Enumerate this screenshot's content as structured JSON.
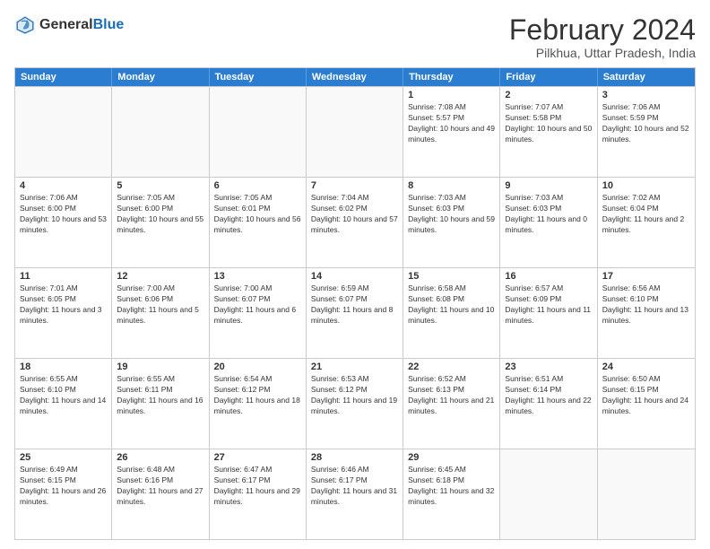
{
  "logo": {
    "general": "General",
    "blue": "Blue"
  },
  "title": "February 2024",
  "location": "Pilkhua, Uttar Pradesh, India",
  "header_days": [
    "Sunday",
    "Monday",
    "Tuesday",
    "Wednesday",
    "Thursday",
    "Friday",
    "Saturday"
  ],
  "rows": [
    [
      {
        "day": "",
        "empty": true
      },
      {
        "day": "",
        "empty": true
      },
      {
        "day": "",
        "empty": true
      },
      {
        "day": "",
        "empty": true
      },
      {
        "day": "1",
        "sunrise": "7:08 AM",
        "sunset": "5:57 PM",
        "daylight": "10 hours and 49 minutes."
      },
      {
        "day": "2",
        "sunrise": "7:07 AM",
        "sunset": "5:58 PM",
        "daylight": "10 hours and 50 minutes."
      },
      {
        "day": "3",
        "sunrise": "7:06 AM",
        "sunset": "5:59 PM",
        "daylight": "10 hours and 52 minutes."
      }
    ],
    [
      {
        "day": "4",
        "sunrise": "7:06 AM",
        "sunset": "6:00 PM",
        "daylight": "10 hours and 53 minutes."
      },
      {
        "day": "5",
        "sunrise": "7:05 AM",
        "sunset": "6:00 PM",
        "daylight": "10 hours and 55 minutes."
      },
      {
        "day": "6",
        "sunrise": "7:05 AM",
        "sunset": "6:01 PM",
        "daylight": "10 hours and 56 minutes."
      },
      {
        "day": "7",
        "sunrise": "7:04 AM",
        "sunset": "6:02 PM",
        "daylight": "10 hours and 57 minutes."
      },
      {
        "day": "8",
        "sunrise": "7:03 AM",
        "sunset": "6:03 PM",
        "daylight": "10 hours and 59 minutes."
      },
      {
        "day": "9",
        "sunrise": "7:03 AM",
        "sunset": "6:03 PM",
        "daylight": "11 hours and 0 minutes."
      },
      {
        "day": "10",
        "sunrise": "7:02 AM",
        "sunset": "6:04 PM",
        "daylight": "11 hours and 2 minutes."
      }
    ],
    [
      {
        "day": "11",
        "sunrise": "7:01 AM",
        "sunset": "6:05 PM",
        "daylight": "11 hours and 3 minutes."
      },
      {
        "day": "12",
        "sunrise": "7:00 AM",
        "sunset": "6:06 PM",
        "daylight": "11 hours and 5 minutes."
      },
      {
        "day": "13",
        "sunrise": "7:00 AM",
        "sunset": "6:07 PM",
        "daylight": "11 hours and 6 minutes."
      },
      {
        "day": "14",
        "sunrise": "6:59 AM",
        "sunset": "6:07 PM",
        "daylight": "11 hours and 8 minutes."
      },
      {
        "day": "15",
        "sunrise": "6:58 AM",
        "sunset": "6:08 PM",
        "daylight": "11 hours and 10 minutes."
      },
      {
        "day": "16",
        "sunrise": "6:57 AM",
        "sunset": "6:09 PM",
        "daylight": "11 hours and 11 minutes."
      },
      {
        "day": "17",
        "sunrise": "6:56 AM",
        "sunset": "6:10 PM",
        "daylight": "11 hours and 13 minutes."
      }
    ],
    [
      {
        "day": "18",
        "sunrise": "6:55 AM",
        "sunset": "6:10 PM",
        "daylight": "11 hours and 14 minutes."
      },
      {
        "day": "19",
        "sunrise": "6:55 AM",
        "sunset": "6:11 PM",
        "daylight": "11 hours and 16 minutes."
      },
      {
        "day": "20",
        "sunrise": "6:54 AM",
        "sunset": "6:12 PM",
        "daylight": "11 hours and 18 minutes."
      },
      {
        "day": "21",
        "sunrise": "6:53 AM",
        "sunset": "6:12 PM",
        "daylight": "11 hours and 19 minutes."
      },
      {
        "day": "22",
        "sunrise": "6:52 AM",
        "sunset": "6:13 PM",
        "daylight": "11 hours and 21 minutes."
      },
      {
        "day": "23",
        "sunrise": "6:51 AM",
        "sunset": "6:14 PM",
        "daylight": "11 hours and 22 minutes."
      },
      {
        "day": "24",
        "sunrise": "6:50 AM",
        "sunset": "6:15 PM",
        "daylight": "11 hours and 24 minutes."
      }
    ],
    [
      {
        "day": "25",
        "sunrise": "6:49 AM",
        "sunset": "6:15 PM",
        "daylight": "11 hours and 26 minutes."
      },
      {
        "day": "26",
        "sunrise": "6:48 AM",
        "sunset": "6:16 PM",
        "daylight": "11 hours and 27 minutes."
      },
      {
        "day": "27",
        "sunrise": "6:47 AM",
        "sunset": "6:17 PM",
        "daylight": "11 hours and 29 minutes."
      },
      {
        "day": "28",
        "sunrise": "6:46 AM",
        "sunset": "6:17 PM",
        "daylight": "11 hours and 31 minutes."
      },
      {
        "day": "29",
        "sunrise": "6:45 AM",
        "sunset": "6:18 PM",
        "daylight": "11 hours and 32 minutes."
      },
      {
        "day": "",
        "empty": true
      },
      {
        "day": "",
        "empty": true
      }
    ]
  ],
  "labels": {
    "sunrise": "Sunrise:",
    "sunset": "Sunset:",
    "daylight": "Daylight:"
  }
}
